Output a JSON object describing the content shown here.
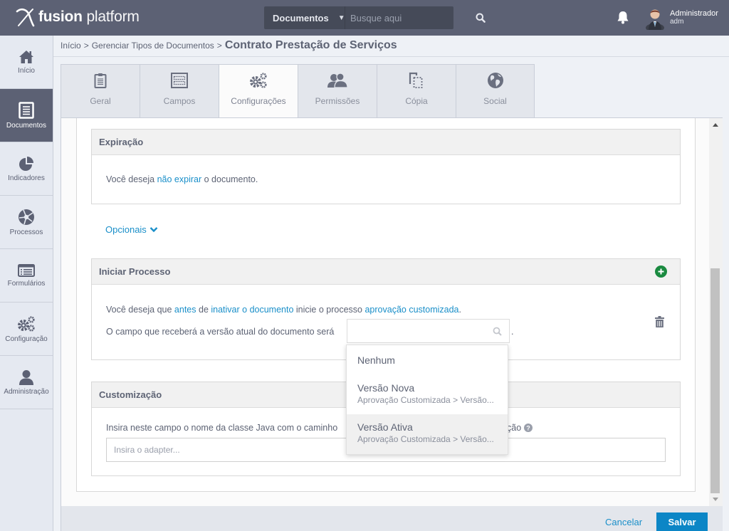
{
  "app": {
    "brand_bold": "fusion",
    "brand_light": "platform"
  },
  "search": {
    "scope": "Documentos",
    "placeholder": "Busque aqui"
  },
  "user": {
    "name": "Administrador",
    "login": "adm"
  },
  "sidebar": {
    "items": [
      {
        "label": "Início",
        "icon": "home-icon"
      },
      {
        "label": "Documentos",
        "icon": "document-icon",
        "active": true
      },
      {
        "label": "Indicadores",
        "icon": "pie-chart-icon"
      },
      {
        "label": "Processos",
        "icon": "aperture-icon"
      },
      {
        "label": "Formulários",
        "icon": "form-list-icon"
      },
      {
        "label": "Configuração",
        "icon": "gears-icon"
      },
      {
        "label": "Administração",
        "icon": "user-icon"
      }
    ]
  },
  "breadcrumb": {
    "items": [
      "Início",
      "Gerenciar Tipos de Documentos"
    ],
    "separator": ">",
    "current": "Contrato Prestação de Serviços"
  },
  "tabs": [
    {
      "label": "Geral",
      "icon": "clipboard-icon"
    },
    {
      "label": "Campos",
      "icon": "fields-icon"
    },
    {
      "label": "Configurações",
      "icon": "gears-icon",
      "active": true
    },
    {
      "label": "Permissões",
      "icon": "users-icon"
    },
    {
      "label": "Cópia",
      "icon": "copy-icon"
    },
    {
      "label": "Social",
      "icon": "globe-icon"
    }
  ],
  "expiracao": {
    "title": "Expiração",
    "text_before": "Você deseja ",
    "link": "não expirar",
    "text_after": " o documento."
  },
  "opcionais": {
    "label": "Opcionais"
  },
  "iniciar_processo": {
    "title": "Iniciar Processo",
    "line1": {
      "t1": "Você deseja que ",
      "l1": "antes",
      "t2": " de ",
      "l2": "inativar o documento",
      "t3": " inicie o processo ",
      "l3": "aprovação customizada",
      "t4": "."
    },
    "line2": {
      "text": "O campo que receberá a versão atual do documento será",
      "select_value": "",
      "after": "."
    },
    "dropdown": {
      "options": [
        {
          "title": "Nenhum",
          "subtitle": ""
        },
        {
          "title": "Versão Nova",
          "subtitle": "Aprovação Customizada > Versão..."
        },
        {
          "title": "Versão Ativa",
          "subtitle": "Aprovação Customizada > Versão...",
          "hovered": true
        }
      ]
    }
  },
  "customizacao": {
    "title": "Customização",
    "description_start": "Insira neste campo o nome da classe Java com o caminho",
    "description_end": "ção",
    "input_placeholder": "Insira o adapter...",
    "input_value": ""
  },
  "footer": {
    "cancel": "Cancelar",
    "save": "Salvar"
  },
  "colors": {
    "topbar": "#5c6174",
    "link": "#1a8fc9",
    "primary_button": "#0c86c6",
    "add_button": "#1a8a40"
  }
}
